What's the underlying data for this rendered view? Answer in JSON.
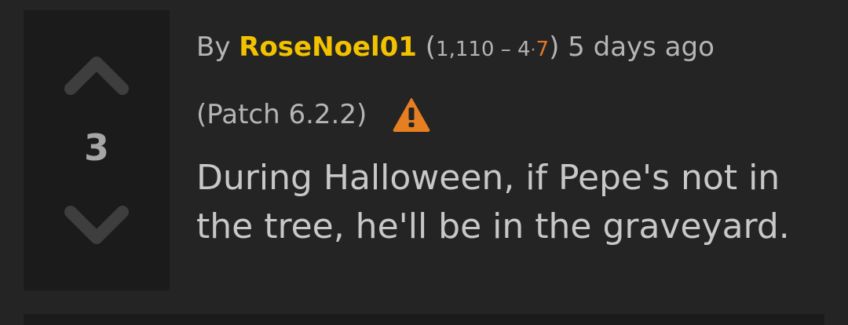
{
  "comment": {
    "score": "3",
    "byline_prefix": "By",
    "author": "RoseNoel01",
    "reputation": {
      "open": "(",
      "points": "1,110",
      "separator": "–",
      "level_major": "4",
      "level_dot": "·",
      "level_minor": "7",
      "close": ")"
    },
    "timestamp": "5 days ago",
    "patch": "(Patch 6.2.2)",
    "text": "During Halloween, if Pepe's not in the tree, he'll be in the graveyard."
  },
  "icons": {
    "upvote": "chevron-up-icon",
    "downvote": "chevron-down-icon",
    "warning": "warning-triangle-icon"
  },
  "colors": {
    "background": "#242424",
    "panel": "#1b1b1b",
    "author": "#f2c200",
    "warning": "#e67e22",
    "text": "#c8c8c8",
    "accent": "#e0782b"
  }
}
